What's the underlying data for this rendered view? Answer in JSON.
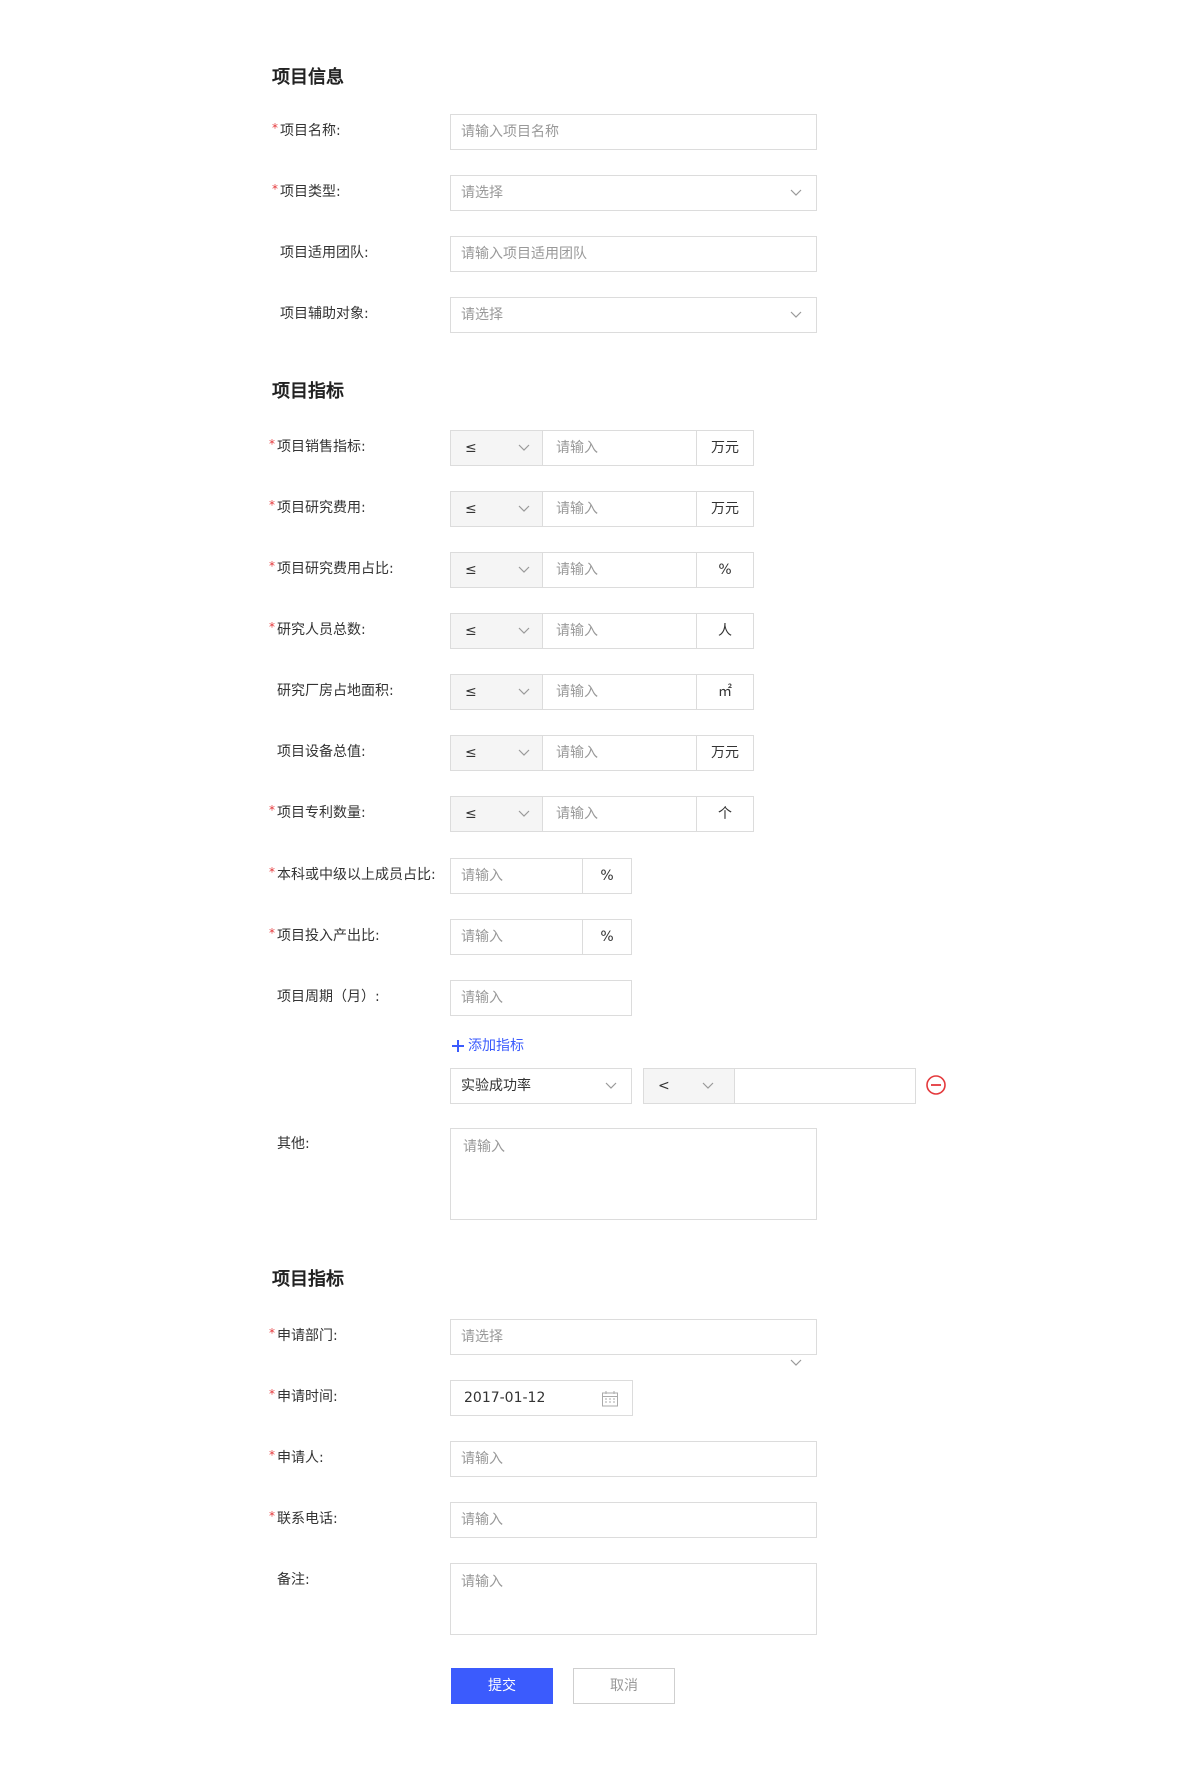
{
  "sections": {
    "info_title": "项目信息",
    "metrics_title": "项目指标",
    "apply_title": "项目指标"
  },
  "info": {
    "name_label": "项目名称:",
    "name_placeholder": "请输入项目名称",
    "type_label": "项目类型:",
    "type_placeholder": "请选择",
    "team_label": "项目适用团队:",
    "team_placeholder": "请输入项目适用团队",
    "target_label": "项目辅助对象:",
    "target_placeholder": "请选择"
  },
  "metrics": {
    "rows": [
      {
        "label": "项目销售指标:",
        "operator": "≤",
        "placeholder": "请输入",
        "unit": "万元",
        "required": true
      },
      {
        "label": "项目研究费用:",
        "operator": "≤",
        "placeholder": "请输入",
        "unit": "万元",
        "required": true
      },
      {
        "label": "项目研究费用占比:",
        "operator": "≤",
        "placeholder": "请输入",
        "unit": "%",
        "required": true
      },
      {
        "label": "研究人员总数:",
        "operator": "≤",
        "placeholder": "请输入",
        "unit": "人",
        "required": true
      },
      {
        "label": "研究厂房占地面积:",
        "operator": "≤",
        "placeholder": "请输入",
        "unit": "㎡",
        "required": false
      },
      {
        "label": "项目设备总值:",
        "operator": "≤",
        "placeholder": "请输入",
        "unit": "万元",
        "required": false
      },
      {
        "label": "项目专利数量:",
        "operator": "≤",
        "placeholder": "请输入",
        "unit": "个",
        "required": true
      }
    ],
    "ratio_rows": [
      {
        "label": "本科或中级以上成员占比:",
        "placeholder": "请输入",
        "unit": "%",
        "required": true
      },
      {
        "label": "项目投入产出比:",
        "placeholder": "请输入",
        "unit": "%",
        "required": true
      }
    ],
    "cycle_label": "项目周期（月）:",
    "cycle_placeholder": "请输入",
    "add_metric": "添加指标",
    "custom_metric": {
      "name": "实验成功率",
      "operator": "<"
    },
    "other_label": "其他:",
    "other_placeholder": "请输入"
  },
  "apply": {
    "dept_label": "申请部门:",
    "dept_placeholder": "请选择",
    "date_label": "申请时间:",
    "date_value": "2017-01-12",
    "applicant_label": "申请人:",
    "applicant_placeholder": "请输入",
    "phone_label": "联系电话:",
    "phone_placeholder": "请输入",
    "note_label": "备注:",
    "note_placeholder": "请输入"
  },
  "buttons": {
    "submit": "提交",
    "cancel": "取消"
  },
  "colors": {
    "primary": "#3b5bfd",
    "required": "#e4393c",
    "remove": "#e4393c"
  }
}
